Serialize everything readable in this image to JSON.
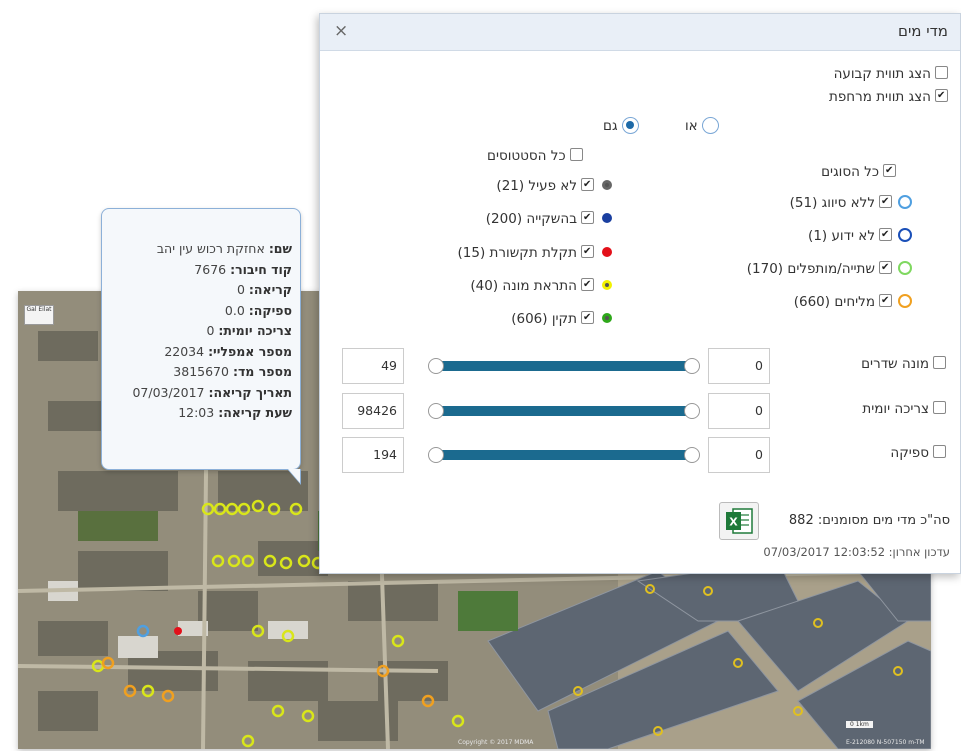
{
  "dialog": {
    "title": "מדי מים",
    "close_glyph": "×",
    "fixed_label": "הצג תווית קבועה",
    "floating_label": "הצג תווית מרחפת",
    "radio_or": "או",
    "radio_and": "גם",
    "all_statuses": "כל הסטטוסים",
    "all_types": "כל הסוגים",
    "statuses": [
      {
        "label": "לא פעיל (21)",
        "color": "#666666"
      },
      {
        "label": "בהשקייה (200)",
        "color": "#1a3fa0"
      },
      {
        "label": "תקלת תקשורת (15)",
        "color": "#e3101a"
      },
      {
        "label": "התראת מונה (40)",
        "color": "#f2f200"
      },
      {
        "label": "תקין (606)",
        "color": "#2ea81a"
      }
    ],
    "types": [
      {
        "label": "ללא סיווג (51)",
        "color": "#4f9fe0"
      },
      {
        "label": "לא ידוע (1)",
        "color": "#1a4fb8"
      },
      {
        "label": "שתייה/מותפלים (170)",
        "color": "#7fd860"
      },
      {
        "label": "מליחים (660)",
        "color": "#f0a020"
      }
    ],
    "filters": [
      {
        "label": "מונה שדרים",
        "min": "0",
        "max": "49"
      },
      {
        "label": "צריכה יומית",
        "min": "0",
        "max": "98426"
      },
      {
        "label": "ספיקה",
        "min": "0",
        "max": "194"
      }
    ],
    "total": "סה\"כ מדי מים מסומנים: 882",
    "updated": "עדכון אחרון: 12:03:52 07/03/2017",
    "excel_icon": "excel-export-icon"
  },
  "popup": {
    "rows": [
      {
        "key": "שם:",
        "value": "אחזקת רכוש עין יהב"
      },
      {
        "key": "קוד חיבור:",
        "value": "7676"
      },
      {
        "key": "קריאה:",
        "value": "0"
      },
      {
        "key": "ספיקה:",
        "value": "0.0"
      },
      {
        "key": "צריכה יומית:",
        "value": "0"
      },
      {
        "key": "מספר אמפליי:",
        "value": "22034"
      },
      {
        "key": "מספר מד:",
        "value": "3815670"
      },
      {
        "key": "תאריך קריאה:",
        "value": "07/03/2017"
      },
      {
        "key": "שעת קריאה:",
        "value": "12:03"
      }
    ]
  },
  "map": {
    "badge": "Gal Eilat",
    "copyright": "Copyright © 2017 MDMA",
    "scale": "0    1km",
    "coords": "E-212080 N-507150 m-TM"
  }
}
